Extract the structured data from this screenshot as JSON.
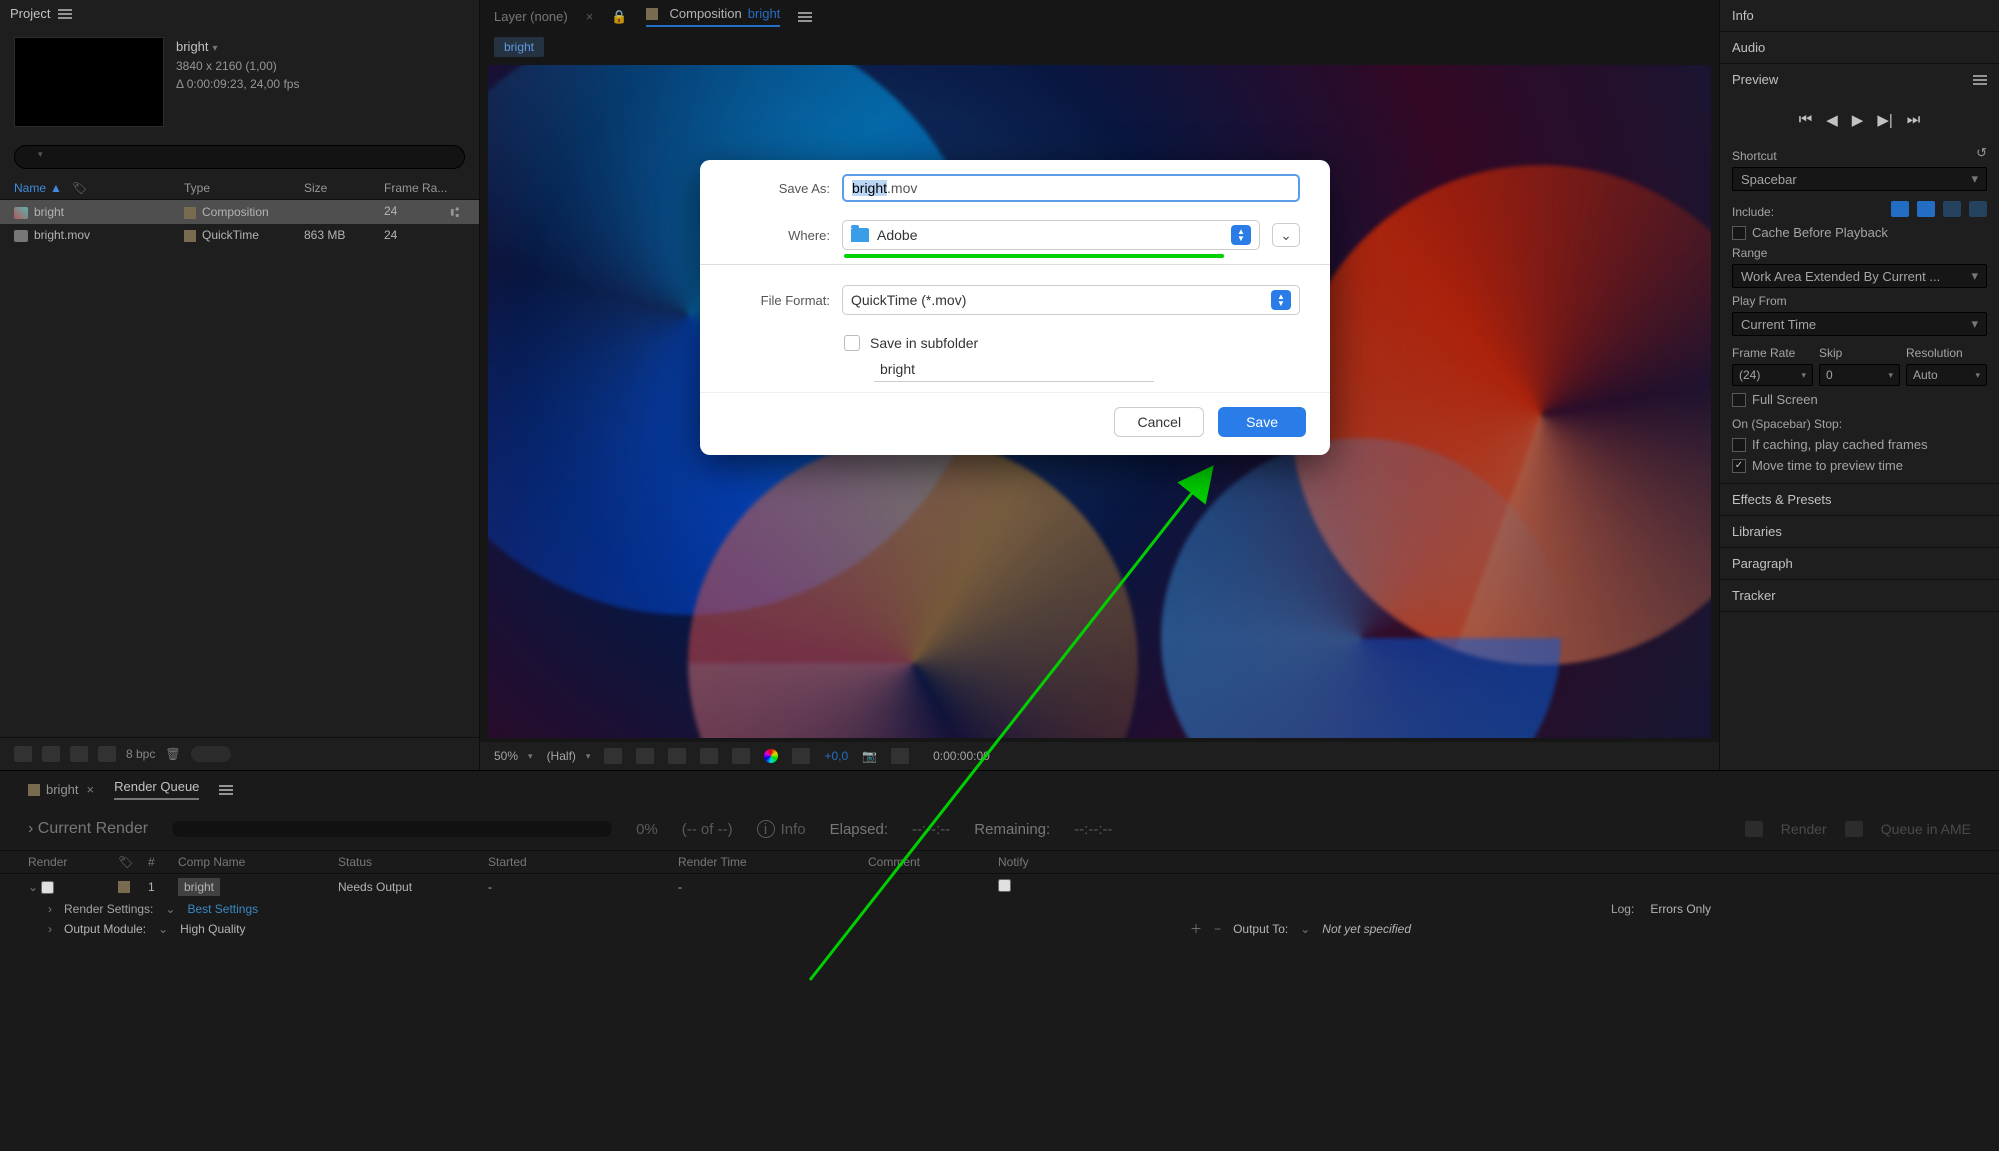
{
  "project": {
    "panel_title": "Project",
    "comp_name": "bright",
    "comp_dims": "3840 x 2160 (1,00)",
    "comp_duration": "Δ 0:00:09:23, 24,00 fps",
    "search_placeholder": "",
    "headers": {
      "name": "Name",
      "type": "Type",
      "size": "Size",
      "framerate": "Frame Ra..."
    },
    "rows": [
      {
        "name": "bright",
        "type": "Composition",
        "size": "",
        "fr": "24",
        "selected": true,
        "kind": "comp"
      },
      {
        "name": "bright.mov",
        "type": "QuickTime",
        "size": "863 MB",
        "fr": "24",
        "selected": false,
        "kind": "file"
      }
    ],
    "footer_bpc": "8 bpc"
  },
  "comp": {
    "tab1": "Layer (none)",
    "tab2_prefix": "Composition",
    "tab2_name": "bright",
    "chip": "bright",
    "toolbar": {
      "zoom": "50%",
      "res": "(Half)",
      "tc_prefix": "+0,0",
      "timecode": "0:00:00:00"
    }
  },
  "right": {
    "info": "Info",
    "audio": "Audio",
    "preview": "Preview",
    "shortcut_label": "Shortcut",
    "shortcut_value": "Spacebar",
    "include_label": "Include:",
    "cache_label": "Cache Before Playback",
    "range_label": "Range",
    "range_value": "Work Area Extended By Current ...",
    "playfrom_label": "Play From",
    "playfrom_value": "Current Time",
    "fr_label": "Frame Rate",
    "skip_label": "Skip",
    "res_label": "Resolution",
    "fr_value": "(24)",
    "skip_value": "0",
    "res_value": "Auto",
    "fullscreen": "Full Screen",
    "onstop_label": "On (Spacebar) Stop:",
    "onstop_a": "If caching, play cached frames",
    "onstop_b": "Move time to preview time",
    "effects": "Effects & Presets",
    "libraries": "Libraries",
    "paragraph": "Paragraph",
    "tracker": "Tracker"
  },
  "bottom": {
    "tab_bright": "bright",
    "tab_rq": "Render Queue",
    "current_render": "Current Render",
    "percent": "0%",
    "frames": "(-- of --)",
    "info": "Info",
    "elapsed_l": "Elapsed:",
    "elapsed_v": "--:--:--",
    "remaining_l": "Remaining:",
    "remaining_v": "--:--:--",
    "btn_render": "Render",
    "btn_ame": "Queue in AME",
    "headers": {
      "render": "Render",
      "tag": "",
      "num": "#",
      "name": "Comp Name",
      "status": "Status",
      "started": "Started",
      "rtime": "Render Time",
      "comment": "Comment",
      "notify": "Notify"
    },
    "row": {
      "num": "1",
      "name": "bright",
      "status": "Needs Output",
      "started": "-",
      "rtime": "-"
    },
    "render_settings_l": "Render Settings:",
    "render_settings_v": "Best Settings",
    "log_l": "Log:",
    "log_v": "Errors Only",
    "output_module_l": "Output Module:",
    "output_module_v": "High Quality",
    "output_to_l": "Output To:",
    "output_to_v": "Not yet specified"
  },
  "dialog": {
    "saveas_l": "Save As:",
    "filename_base": "bright",
    "filename_ext": ".mov",
    "where_l": "Where:",
    "where_v": "Adobe",
    "ff_l": "File Format:",
    "ff_v": "QuickTime (*.mov)",
    "subfolder_l": "Save in subfolder",
    "subfolder_v": "bright",
    "cancel": "Cancel",
    "save": "Save"
  }
}
